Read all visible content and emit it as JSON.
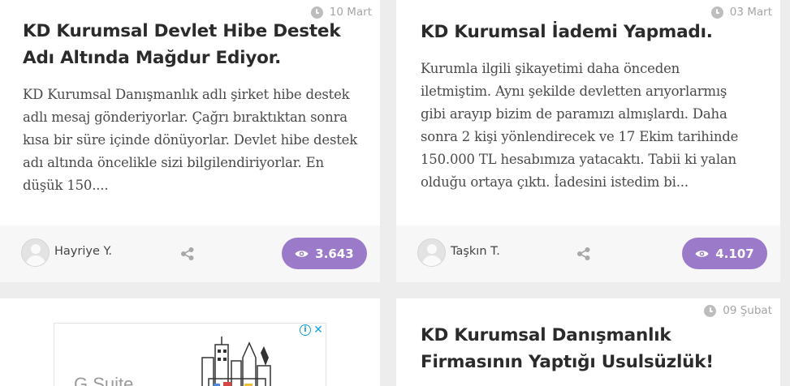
{
  "cards": [
    {
      "date": "10 Mart",
      "title_line1": "KD Kurumsal Devlet Hibe Destek",
      "title_line2": "Adı Altında Mağdur Ediyor.",
      "excerpt_lines": [
        "KD Kurumsal Danışmanlık adlı şirket hibe destek",
        "adlı mesaj gönderiyorlar. Çağrı bıraktıktan sonra",
        "kısa bir süre içinde dönüyorlar. Devlet hibe destek",
        "adı altında öncelikle sizi bilgilendiriyorlar. En",
        "düşük 150...."
      ],
      "author": "Hayriye Y.",
      "views": "3.643"
    },
    {
      "date": "03 Mart",
      "title_line1": "KD Kurumsal İademi Yapmadı.",
      "excerpt_lines": [
        "Kurumla ilgili şikayetimi daha önceden",
        "iletmiştim. Aynı şekilde devletten arıyorlarmış",
        "gibi arayıp bizim de paramızı almışlardı. Daha",
        "sonra 2 kişi yönlendirecek ve 17 Ekim tarihinde",
        "150.000 TL hesabımıza yatacaktı. Tabii ki yalan",
        "olduğu ortaya çıktı. İadesini istedim bi..."
      ],
      "author": "Taşkın T.",
      "views": "4.107"
    },
    {
      "ad_brand": "G Suite"
    },
    {
      "date": "09 Şubat",
      "title_line1": "KD Kurumsal Danışmanlık",
      "title_line2": "Firmasının Yaptığı Usulsüzlük!"
    }
  ],
  "icons": {
    "date": "clock-icon",
    "share": "share-icon",
    "views": "eye-icon",
    "ad_info": "info-icon",
    "ad_close": "close-icon"
  },
  "ad": {
    "info_glyph": "i",
    "close_glyph": "✕"
  },
  "colors": {
    "accent": "#9b7ac9",
    "title": "#2b2b2b",
    "excerpt": "#4a4a4a",
    "meta": "#a5a5a5",
    "background": "#ededed",
    "footer": "#f7f7f7"
  }
}
